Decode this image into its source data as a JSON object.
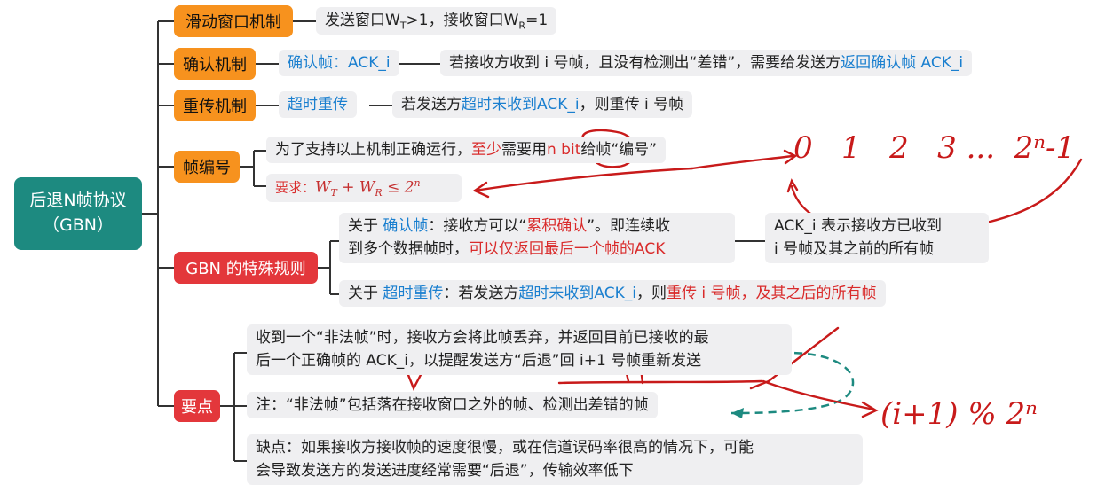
{
  "root": {
    "line1": "后退N帧协议",
    "line2": "（GBN）"
  },
  "categories": {
    "sliding": "滑动窗口机制",
    "confirm": "确认机制",
    "resend": "重传机制",
    "numbering": "帧编号",
    "gbn_rules": "GBN 的特殊规则",
    "key_points": "要点"
  },
  "sliding": {
    "text_a": "发送窗口W",
    "sub_t": "T",
    "text_b": ">1，接收窗口W",
    "sub_r": "R",
    "text_c": "=1"
  },
  "confirm": {
    "label": "确认帧：ACK_i",
    "text_a": "若接收方收到 i 号帧，且没有检测出“差错”，需要给发送方",
    "text_b": "返回确认帧 ACK_i"
  },
  "resend": {
    "label": "超时重传",
    "text_a": "若发送方",
    "text_b": "超时未收到ACK_i",
    "text_c": "，则重传 i 号帧"
  },
  "numbering": {
    "text_a": "为了支持以上机制正确运行，",
    "text_b": "至少",
    "text_c": "需要用",
    "text_d": "n bit",
    "text_e": "给帧“编号”",
    "req_label": "要求：",
    "req_formula": "W",
    "req_sub_t": "T",
    "req_plus": " + W",
    "req_sub_r": "R",
    "req_le": " ≤ 2",
    "req_sup": "n"
  },
  "gbn": {
    "rule1_a": "关于 ",
    "rule1_b": "确认帧",
    "rule1_c": "：接收方可以“",
    "rule1_d": "累积确认",
    "rule1_e": "”。即连续收",
    "rule1_f": "到多个数据帧时，",
    "rule1_g": "可以仅返回最后一个帧的ACK",
    "rule1_note_a": "ACK_i 表示接收方已收到",
    "rule1_note_b": "i 号帧及其之前的所有帧",
    "rule2_a": "关于 ",
    "rule2_b": "超时重传",
    "rule2_c": "：若发送方",
    "rule2_d": "超时未收到ACK_i",
    "rule2_e": "，则",
    "rule2_f": "重传 i 号帧，及其之后的所有帧"
  },
  "key": {
    "p1_a": "收到一个“非法帧”时，接收方会将此帧丢弃，并返回目前已接收的最",
    "p1_b": "后一个正确帧的 ACK_i，以提醒发送方“后退”回 i+1 号帧重新发送",
    "p2": "注：“非法帧”包括落在接收窗口之外的帧、检测出差错的帧",
    "p3_a": "缺点：如果接收方接收帧的速度很慢，或在信道误码率很高的情况下，可能",
    "p3_b": "会导致发送方的发送进度经常需要“后退”，传输效率低下"
  },
  "handwriting": {
    "sequence": "0   1   2   3 ...  2ⁿ-1",
    "formula": "(i+1) % 2ⁿ"
  },
  "colors": {
    "root": "#1d8a80",
    "orange": "#f7921e",
    "red": "#e3373b",
    "blue": "#1a7fcf",
    "ink": "#c81a1a",
    "teal_dash": "#1d8a80"
  }
}
